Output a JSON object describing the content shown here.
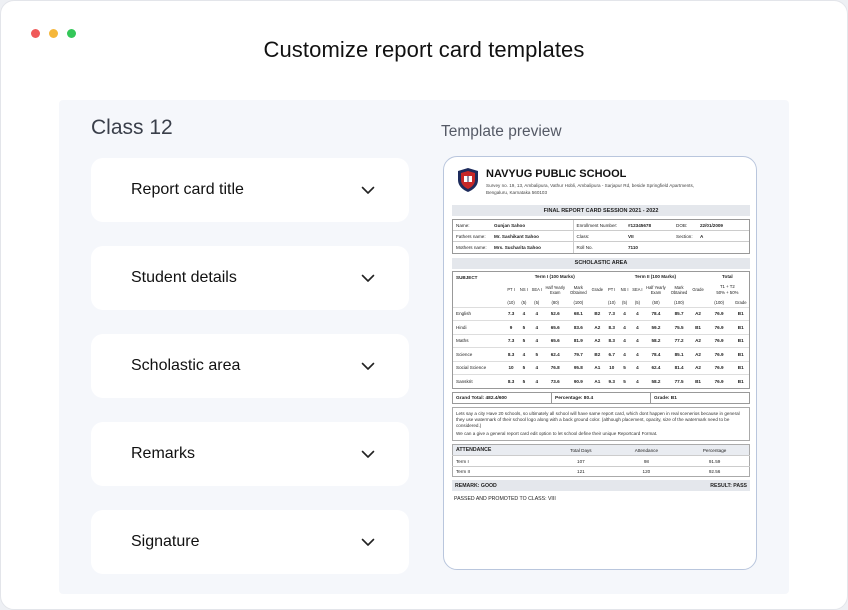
{
  "window": {
    "title": "Customize report card templates",
    "dot_colors": [
      "#f05a5a",
      "#f5b73b",
      "#34c759"
    ]
  },
  "editor": {
    "class_label": "Class 12",
    "sections": [
      {
        "label": "Report card title",
        "icon": "chevron-down-icon"
      },
      {
        "label": "Student details",
        "icon": "chevron-down-icon"
      },
      {
        "label": "Scholastic area",
        "icon": "chevron-down-icon"
      },
      {
        "label": "Remarks",
        "icon": "chevron-down-icon"
      },
      {
        "label": "Signature",
        "icon": "chevron-down-icon"
      }
    ]
  },
  "preview": {
    "label": "Template preview",
    "school_name": "NAVYUG PUBLIC SCHOOL",
    "school_address": "Survey no. 19, 13, Ambalipura, Vathur Hobli, Ambalipura - Sarjapur Rd, beside Springfield Apartments, Bengaluru, Karnataka 560103",
    "report_title": "FINAL REPORT CARD SESSION 2021 - 2022",
    "details": {
      "name_label": "Name:",
      "name": "Gunjan Sahoo",
      "enroll_label": "Enrollment Number:",
      "enroll": "#12345678",
      "dob_label": "DOB:",
      "dob": "22/01/2009",
      "father_label": "Fathers name:",
      "father": "Mr. Sashikant Sahoo",
      "class_label": "Class:",
      "class": "VII",
      "section_label": "Section:",
      "section": "A",
      "mother_label": "Mothers name:",
      "mother": "Mrs. Sucharita Sahoo",
      "roll_label": "Roll No.",
      "roll": "7110"
    },
    "scholastic_title": "SCHOLASTIC AREA",
    "scholastic": {
      "subject_header": "SUBJECT",
      "term1_header": "Term I (100 Marks)",
      "term2_header": "Term II (100 Marks)",
      "total_header": "Total",
      "total_formula": "T1 + T2",
      "total_weights": "50% + 50%",
      "sub_headers": [
        "PT I",
        "NS I",
        "SEA I",
        "Half Yearly Exam",
        "Mark Obtained",
        "Grade",
        "PT I",
        "NS I",
        "SEA I",
        "Half Yearly Exam",
        "Mark Obtained",
        "Grade"
      ],
      "max_marks": [
        "(10)",
        "(5)",
        "(5)",
        "(80)",
        "(100)",
        "",
        "(10)",
        "(5)",
        "(5)",
        "(50)",
        "(100)",
        "",
        "(100)",
        "Grade"
      ],
      "rows": [
        {
          "subject": "English",
          "cells": [
            "7.3",
            "4",
            "4",
            "52.6",
            "68.1",
            "B2",
            "7.3",
            "4",
            "4",
            "78.4",
            "85.7",
            "A2",
            "76.9",
            "B1"
          ]
        },
        {
          "subject": "Hindi",
          "cells": [
            "9",
            "5",
            "4",
            "65.6",
            "83.6",
            "A2",
            "8.3",
            "4",
            "4",
            "59.2",
            "75.5",
            "B1",
            "76.9",
            "B1"
          ]
        },
        {
          "subject": "Maths",
          "cells": [
            "7.3",
            "5",
            "4",
            "65.6",
            "81.9",
            "A2",
            "8.3",
            "4",
            "4",
            "58.2",
            "77.2",
            "A2",
            "76.9",
            "B1"
          ]
        },
        {
          "subject": "Science",
          "cells": [
            "8.3",
            "4",
            "5",
            "62.4",
            "79.7",
            "B2",
            "6.7",
            "4",
            "4",
            "78.4",
            "85.1",
            "A2",
            "76.9",
            "B1"
          ]
        },
        {
          "subject": "Social Science",
          "cells": [
            "10",
            "5",
            "4",
            "76.8",
            "95.8",
            "A1",
            "10",
            "5",
            "4",
            "62.4",
            "81.4",
            "A2",
            "76.9",
            "B1"
          ]
        },
        {
          "subject": "Sanskrit",
          "cells": [
            "8.3",
            "5",
            "4",
            "73.6",
            "90.9",
            "A1",
            "9.3",
            "5",
            "4",
            "58.2",
            "77.5",
            "B1",
            "76.9",
            "B1"
          ]
        }
      ]
    },
    "totals": {
      "grand_total": "Grand Total: 482.4/600",
      "percentage": "Percentage: 80.4",
      "grade": "Grade: B1"
    },
    "remarks_text": "Lets say a city Have 20 schools, so ultimately all school will have same report card, which dont happen in real scenerios because in general they use watermark of their school logo along with a back ground color. (although placement, opacity, size of the watermark need to be considered.)",
    "remarks_text2": "We can a give a general report card edit option to let school define their unique Reportcard Format.",
    "attendance": {
      "title": "ATTENDANCE",
      "headers": [
        "Total Days",
        "Attendance",
        "Percentage"
      ],
      "rows": [
        {
          "term": "Term I",
          "total": "107",
          "attended": "98",
          "percent": "91.59"
        },
        {
          "term": "Term II",
          "total": "121",
          "attended": "120",
          "percent": "92.56"
        }
      ]
    },
    "remark": "REMARK: GOOD",
    "result": "RESULT: PASS",
    "promoted": "PASSED AND PROMOTED TO CLASS: VIII"
  }
}
